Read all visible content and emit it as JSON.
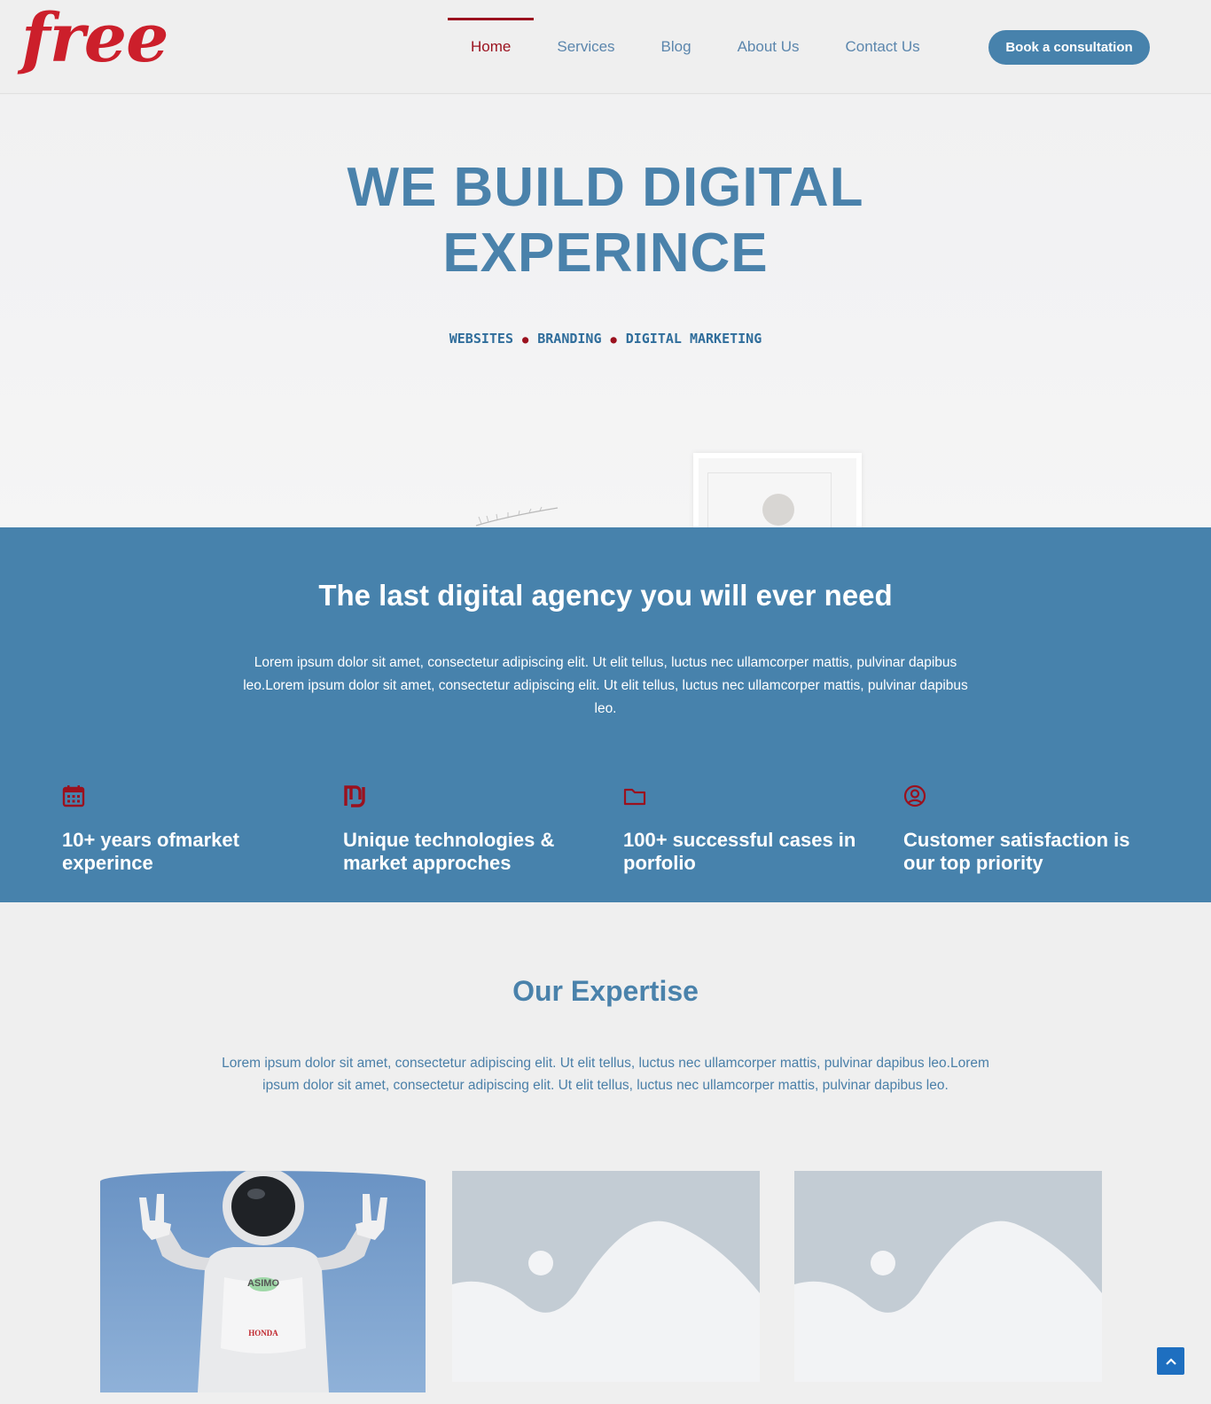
{
  "header": {
    "logo_text": "free",
    "nav": [
      {
        "label": "Home",
        "active": true
      },
      {
        "label": "Services",
        "active": false
      },
      {
        "label": "Blog",
        "active": false
      },
      {
        "label": "About Us",
        "active": false
      },
      {
        "label": "Contact Us",
        "active": false
      }
    ],
    "cta_label": "Book a consultation"
  },
  "hero": {
    "title_line1": "WE BUILD DIGITAL",
    "title_line2": "EXPERINCE",
    "tags": [
      "WEBSITES",
      "BRANDING",
      "DIGITAL MARKETING"
    ],
    "separator": "●"
  },
  "agency": {
    "title": "The last digital agency you will ever need",
    "text": "Lorem ipsum dolor sit amet, consectetur adipiscing elit. Ut elit tellus, luctus nec ullamcorper mattis, pulvinar dapibus leo.Lorem ipsum dolor sit amet, consectetur adipiscing elit. Ut elit tellus, luctus nec ullamcorper mattis, pulvinar dapibus leo.",
    "features": [
      {
        "icon": "calendar-icon",
        "title": "10+ years ofmarket experince"
      },
      {
        "icon": "shekel-icon",
        "title": "Unique technologies & market approches"
      },
      {
        "icon": "folder-icon",
        "title": "100+ successful cases in porfolio"
      },
      {
        "icon": "user-circle-icon",
        "title": "Customer satisfaction is our top priority"
      }
    ]
  },
  "expertise": {
    "title": "Our Expertise",
    "text": "Lorem ipsum dolor sit amet, consectetur adipiscing elit. Ut elit tellus, luctus nec ullamcorper mattis, pulvinar dapibus leo.Lorem ipsum dolor sit amet, consectetur adipiscing elit. Ut elit tellus, luctus nec ullamcorper mattis, pulvinar dapibus leo.",
    "robot_labels": [
      "ASIMO",
      "HONDA"
    ]
  },
  "colors": {
    "brand_red": "#cc1f2b",
    "accent_blue": "#4782ac",
    "active_red": "#9b111e"
  }
}
